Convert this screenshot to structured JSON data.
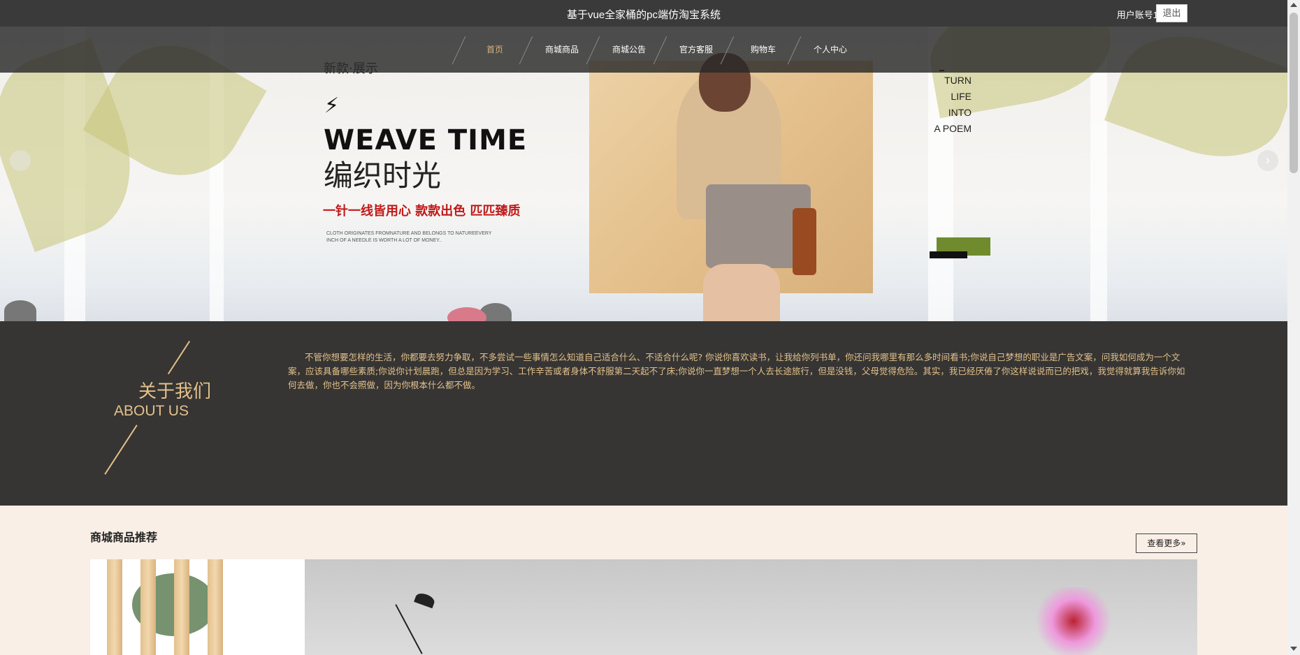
{
  "header": {
    "title": "基于vue全家桶的pc端仿淘宝系统",
    "user": "用户账号1",
    "logout_label": "退出"
  },
  "nav": {
    "items": [
      "首页",
      "商城商品",
      "商城公告",
      "官方客服",
      "购物车",
      "个人中心"
    ],
    "active_index": 0
  },
  "banner": {
    "small_title": "新款·展示",
    "headline_en": "WEAVE TIME",
    "headline_cn": "编织时光",
    "tagline": "一针一线皆用心 款款出色 匹匹臻质",
    "fine_print": "CLOTH ORIGINATES FROMNATURE AND BELONGS TO NATUREEVERY INCH OF A NEEDLE IS WORTH A LOT OF MONEY..",
    "poem_lines": [
      "TURN",
      "LIFE",
      "INTO",
      "A POEM"
    ],
    "next_arrow": "›"
  },
  "about": {
    "title_cn": "关于我们",
    "title_en": "ABOUT US",
    "text": "不管你想要怎样的生活，你都要去努力争取，不多尝试一些事情怎么知道自己适合什么、不适合什么呢? 你说你喜欢读书，让我给你列书单，你还问我哪里有那么多时间看书;你说自己梦想的职业是广告文案，问我如何成为一个文案，应该具备哪些素质;你说你计划晨跑，但总是因为学习、工作辛苦或者身体不舒服第二天起不了床;你说你一直梦想一个人去长途旅行，但是没钱，父母觉得危险。其实，我已经厌倦了你这样说说而已的把戏，我觉得就算我告诉你如何去做，你也不会照做，因为你根本什么都不做。"
  },
  "recommend": {
    "title": "商城商品推荐",
    "more_label": "查看更多»"
  },
  "colors": {
    "accent_gold": "#e3c18a",
    "dark_bg": "#363534",
    "nav_active": "#d9b27a",
    "tagline_red": "#c01919",
    "cream_bg": "#f9efe6"
  }
}
